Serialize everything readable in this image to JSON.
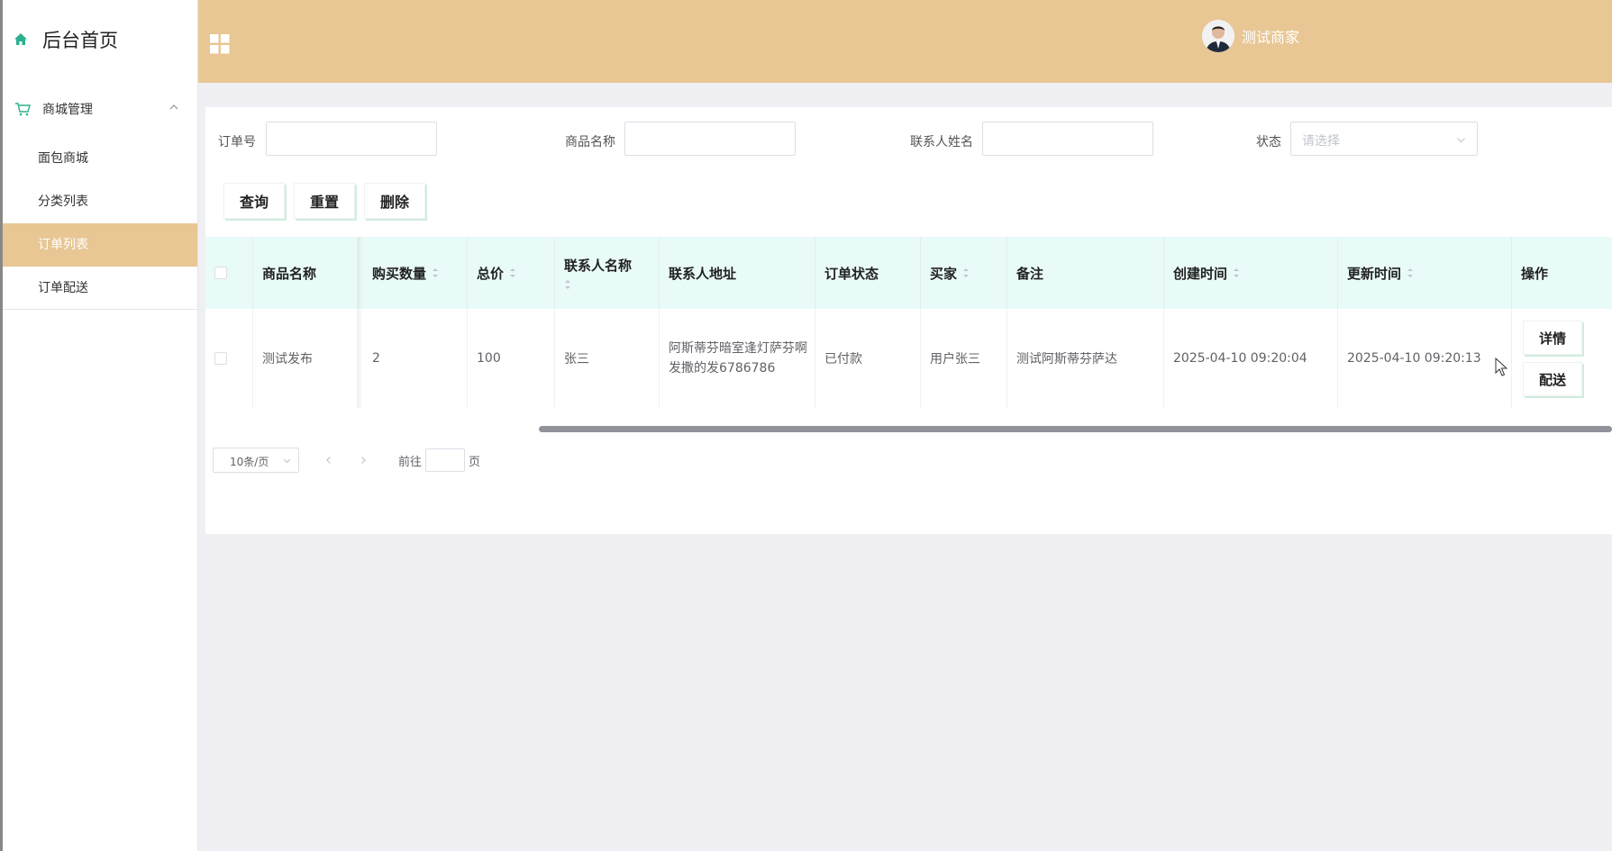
{
  "sidebar": {
    "home_label": "后台首页",
    "group_label": "商城管理",
    "items": [
      {
        "label": "面包商城",
        "active": false
      },
      {
        "label": "分类列表",
        "active": false
      },
      {
        "label": "订单列表",
        "active": true
      },
      {
        "label": "订单配送",
        "active": false
      }
    ]
  },
  "header": {
    "user_name": "测试商家"
  },
  "filters": {
    "order_no_label": "订单号",
    "order_no_value": "",
    "product_label": "商品名称",
    "product_value": "",
    "contact_label": "联系人姓名",
    "contact_value": "",
    "status_label": "状态",
    "status_placeholder": "请选择"
  },
  "actions": {
    "query": "查询",
    "reset": "重置",
    "delete": "删除"
  },
  "table": {
    "columns": [
      "商品名称",
      "购买数量",
      "总价",
      "联系人名称",
      "联系人地址",
      "订单状态",
      "买家",
      "备注",
      "创建时间",
      "更新时间",
      "操作"
    ],
    "rows": [
      {
        "product": "测试发布",
        "qty": "2",
        "total": "100",
        "contact": "张三",
        "address": "阿斯蒂芬暗室逢灯萨芬啊发撒的发6786786",
        "status": "已付款",
        "buyer": "用户张三",
        "remark": "测试阿斯蒂芬萨达",
        "created": "2025-04-10 09:20:04",
        "updated": "2025-04-10 09:20:13",
        "detail_btn": "详情",
        "deliver_btn": "配送"
      }
    ]
  },
  "pagination": {
    "page_size": "10条/页",
    "goto_label": "前往",
    "page_suffix": "页"
  },
  "colors": {
    "accent": "#e8c795",
    "table_header": "#e9fbf8",
    "icon_green": "#2bb08f"
  }
}
